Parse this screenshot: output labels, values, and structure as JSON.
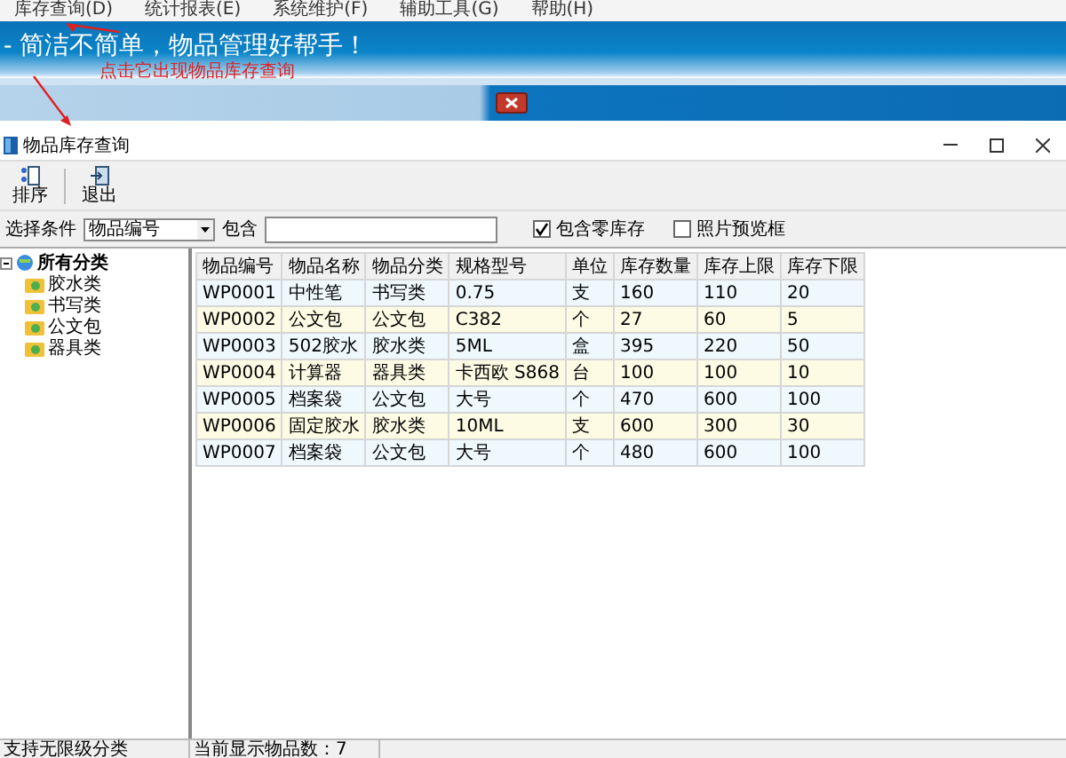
{
  "menu": [
    {
      "label": "库存查询(D)"
    },
    {
      "label": "统计报表(E)"
    },
    {
      "label": "系统维护(F)"
    },
    {
      "label": "辅助工具(G)"
    },
    {
      "label": "帮助(H)"
    }
  ],
  "banner": {
    "slogan": "- 简洁不简单，物品管理好帮手！"
  },
  "annotation": {
    "text": "点击它出现物品库存查询"
  },
  "window": {
    "title": "物品库存查询"
  },
  "toolbar": [
    {
      "kind": "sort",
      "label": "排序"
    },
    {
      "kind": "exit",
      "label": "退出"
    }
  ],
  "filter": {
    "label": "选择条件",
    "dropdown": "物品编号",
    "contains_label": "包含",
    "checkboxes": [
      {
        "label": "包含零库存",
        "checked": true
      },
      {
        "label": "照片预览框",
        "checked": false
      }
    ]
  },
  "tree": {
    "label": "所有分类",
    "expanded": true,
    "children": [
      {
        "label": "胶水类"
      },
      {
        "label": "书写类"
      },
      {
        "label": "公文包"
      },
      {
        "label": "器具类"
      }
    ]
  },
  "table": {
    "columns": [
      "物品编号",
      "物品名称",
      "物品分类",
      "规格型号",
      "单位",
      "库存数量",
      "库存上限",
      "库存下限"
    ],
    "rows": [
      [
        "WP0001",
        "中性笔",
        "书写类",
        "0.75",
        "支",
        "160",
        "110",
        "20"
      ],
      [
        "WP0002",
        "公文包",
        "公文包",
        "C382",
        "个",
        "27",
        "60",
        "5"
      ],
      [
        "WP0003",
        "502胶水",
        "胶水类",
        "5ML",
        "盒",
        "395",
        "220",
        "50"
      ],
      [
        "WP0004",
        "计算器",
        "器具类",
        "卡西欧 S868",
        "台",
        "100",
        "100",
        "10"
      ],
      [
        "WP0005",
        "档案袋",
        "公文包",
        "大号",
        "个",
        "470",
        "600",
        "100"
      ],
      [
        "WP0006",
        "固定胶水",
        "胶水类",
        "10ML",
        "支",
        "600",
        "300",
        "30"
      ],
      [
        "WP0007",
        "档案袋",
        "公文包",
        "大号",
        "个",
        "480",
        "600",
        "100"
      ]
    ]
  },
  "status_bar": [
    "支持无限级分类",
    "当前显示物品数：7"
  ]
}
